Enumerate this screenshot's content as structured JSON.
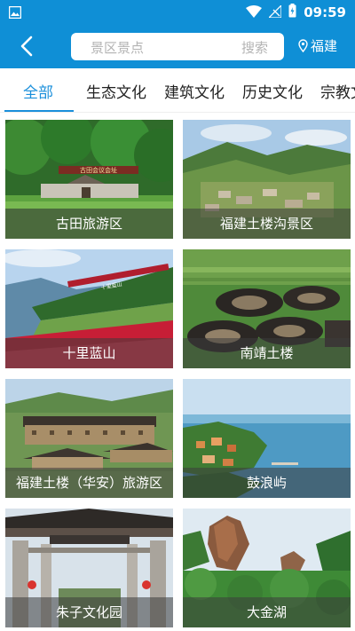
{
  "status_bar": {
    "time": "09:59"
  },
  "header": {
    "search_placeholder": "景区景点",
    "search_button": "搜索",
    "location": "福建"
  },
  "tabs": [
    {
      "label": "全部",
      "active": true
    },
    {
      "label": "生态文化",
      "active": false
    },
    {
      "label": "建筑文化",
      "active": false
    },
    {
      "label": "历史文化",
      "active": false
    },
    {
      "label": "宗教文",
      "active": false
    }
  ],
  "spots": [
    {
      "name": "古田旅游区",
      "sign_text": "古田会议会址"
    },
    {
      "name": "福建土楼沟景区"
    },
    {
      "name": "十里蓝山",
      "sign_text": "十里蓝山"
    },
    {
      "name": "南靖土楼"
    },
    {
      "name": "福建土楼（华安）旅游区"
    },
    {
      "name": "鼓浪屿"
    },
    {
      "name": "朱子文化园"
    },
    {
      "name": "大金湖"
    }
  ],
  "colors": {
    "accent": "#0f8fd6",
    "tab_active": "#1a8fdb"
  }
}
